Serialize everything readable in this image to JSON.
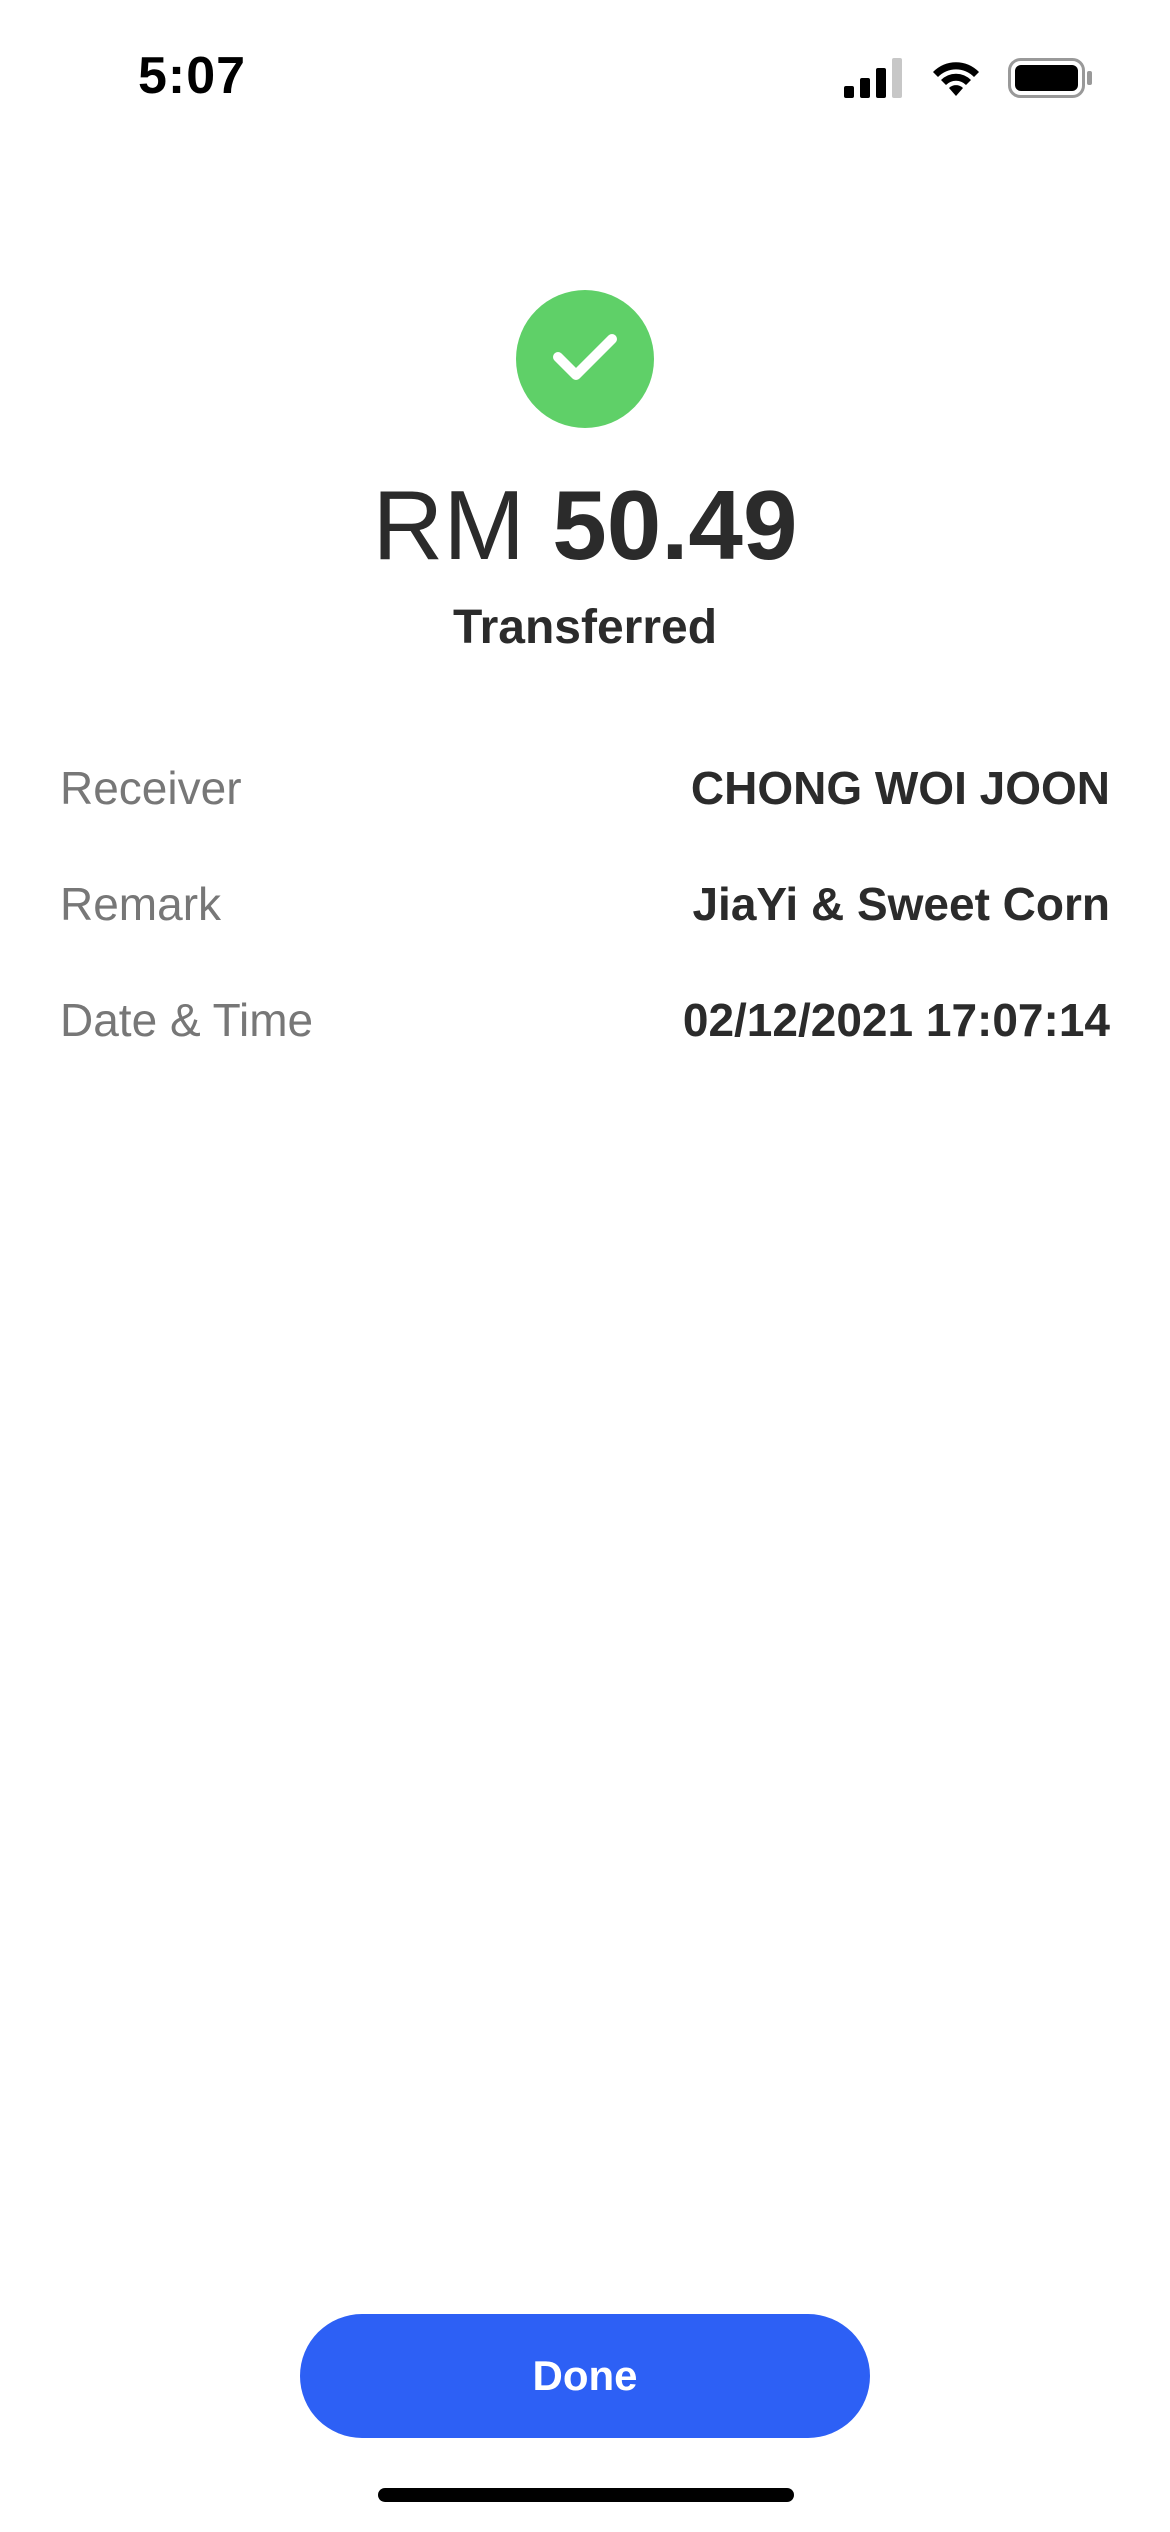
{
  "status_bar": {
    "time": "5:07",
    "icons": [
      "cellular-signal-icon",
      "wifi-icon",
      "battery-icon"
    ]
  },
  "result": {
    "icon": "checkmark-icon",
    "icon_color": "#5fd068",
    "currency": "RM",
    "amount": "50.49",
    "status": "Transferred"
  },
  "details": [
    {
      "label": "Receiver",
      "value": "CHONG WOI JOON"
    },
    {
      "label": "Remark",
      "value": "JiaYi & Sweet Corn"
    },
    {
      "label": "Date & Time",
      "value": "02/12/2021 17:07:14"
    }
  ],
  "actions": {
    "done_label": "Done",
    "accent_color": "#2d60f5"
  }
}
